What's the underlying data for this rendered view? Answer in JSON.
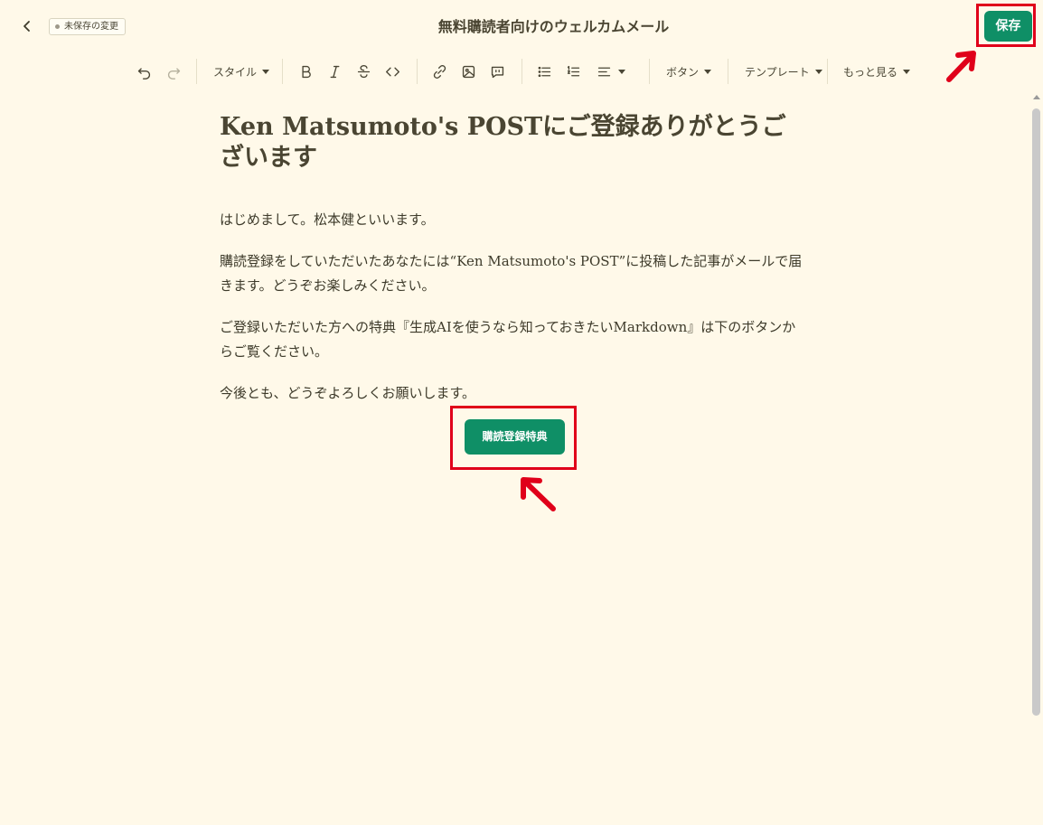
{
  "header": {
    "title": "無料購読者向けのウェルカムメール",
    "unsaved_badge": "未保存の変更",
    "save_label": "保存"
  },
  "toolbar": {
    "style_label": "スタイル",
    "button_label": "ボタン",
    "template_label": "テンプレート",
    "more_label": "もっと見る",
    "icons": [
      "undo-icon",
      "redo-icon",
      "bold-icon",
      "italic-icon",
      "strikethrough-icon",
      "code-icon",
      "link-icon",
      "image-icon",
      "comment-icon",
      "bullet-list-icon",
      "numbered-list-icon",
      "align-icon"
    ]
  },
  "editor": {
    "heading": "Ken Matsumoto's POSTにご登録ありがとうございます",
    "paragraphs": [
      "はじめまして。松本健といいます。",
      "購読登録をしていただいたあなたには“Ken Matsumoto's POST”に投稿した記事がメールで届きます。どうぞお楽しみください。",
      "ご登録いただいた方への特典『生成AIを使うなら知っておきたいMarkdown』は下のボタンからご覧ください。",
      "今後とも、どうぞよろしくお願いします。"
    ],
    "cta_label": "購読登録特典"
  },
  "colors": {
    "background": "#fff9e9",
    "accent_green": "#0f8f66",
    "highlight_red": "#e0001a"
  }
}
